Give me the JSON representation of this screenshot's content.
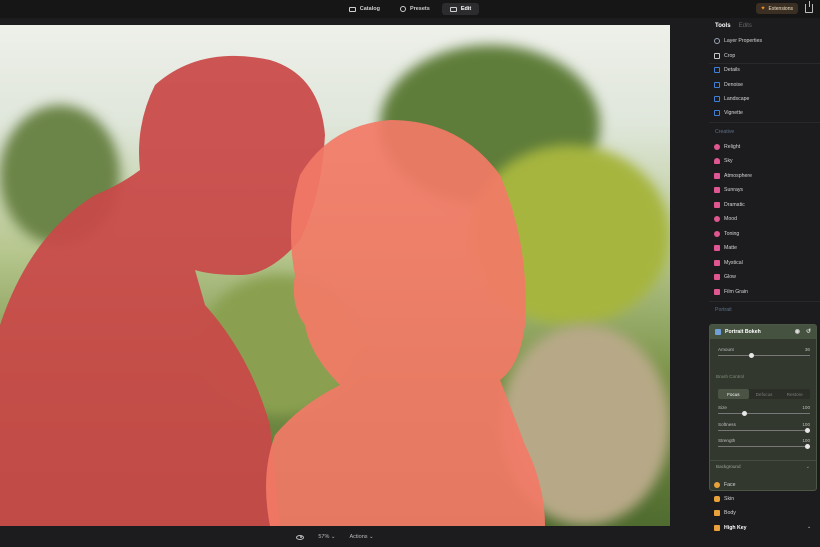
{
  "topbar": {
    "tabs": [
      {
        "label": "Catalog",
        "icon": "folder-icon",
        "active": false
      },
      {
        "label": "Presets",
        "icon": "presets-icon",
        "active": false
      },
      {
        "label": "Edit",
        "icon": "edit-icon",
        "active": true
      }
    ],
    "extensions_label": "Extensions",
    "accent_color": "#ff9a2e"
  },
  "canvas": {
    "zoom": "57%",
    "actions_label": "Actions"
  },
  "panel": {
    "tab_tools": "Tools",
    "tab_edits": "Edits",
    "essentials": [
      {
        "label": "Layer Properties",
        "icon": "layers-icon",
        "color": "#9aa6b8"
      },
      {
        "label": "Crop",
        "icon": "crop-icon",
        "color": "#c7c7c7"
      },
      {
        "label": "Details",
        "icon": "details-icon",
        "color": "#3f7fd8"
      },
      {
        "label": "Denoise",
        "icon": "denoise-icon",
        "color": "#3f7fd8"
      },
      {
        "label": "Landscape",
        "icon": "landscape-icon",
        "color": "#3f7fd8"
      },
      {
        "label": "Vignette",
        "icon": "vignette-icon",
        "color": "#3f7fd8"
      }
    ],
    "creative_label": "Creative",
    "creative": [
      {
        "label": "Relight",
        "icon": "relight-icon",
        "color": "#e05690"
      },
      {
        "label": "Sky",
        "icon": "sky-icon",
        "color": "#e05690"
      },
      {
        "label": "Atmosphere",
        "icon": "atmosphere-icon",
        "color": "#e05690"
      },
      {
        "label": "Sunrays",
        "icon": "sunrays-icon",
        "color": "#e05690"
      },
      {
        "label": "Dramatic",
        "icon": "dramatic-icon",
        "color": "#e05690"
      },
      {
        "label": "Mood",
        "icon": "mood-icon",
        "color": "#e05690"
      },
      {
        "label": "Toning",
        "icon": "toning-icon",
        "color": "#e05690"
      },
      {
        "label": "Matte",
        "icon": "matte-icon",
        "color": "#e05690"
      },
      {
        "label": "Mystical",
        "icon": "mystical-icon",
        "color": "#e05690"
      },
      {
        "label": "Glow",
        "icon": "glow-icon",
        "color": "#e05690"
      },
      {
        "label": "Film Grain",
        "icon": "film-grain-icon",
        "color": "#e05690"
      }
    ],
    "portrait_label": "Portrait",
    "bokeh": {
      "title": "Portrait Bokeh",
      "amount_label": "Amount",
      "amount_value": "36",
      "brush_control_label": "Brush Control",
      "brush_modes": [
        "Focus",
        "Defocus",
        "Restore"
      ],
      "size_label": "Size",
      "size_value": "100",
      "softness_label": "Softness",
      "softness_value": "100",
      "strength_label": "Strength",
      "strength_value": "100",
      "background_label": "Background"
    },
    "portrait_items": [
      {
        "label": "Face",
        "icon": "face-icon",
        "color": "#e9a23b"
      },
      {
        "label": "Skin",
        "icon": "skin-icon",
        "color": "#e9a23b"
      },
      {
        "label": "Body",
        "icon": "body-icon",
        "color": "#e9a23b"
      },
      {
        "label": "High Key",
        "icon": "high-key-icon",
        "color": "#e9a23b"
      }
    ]
  }
}
